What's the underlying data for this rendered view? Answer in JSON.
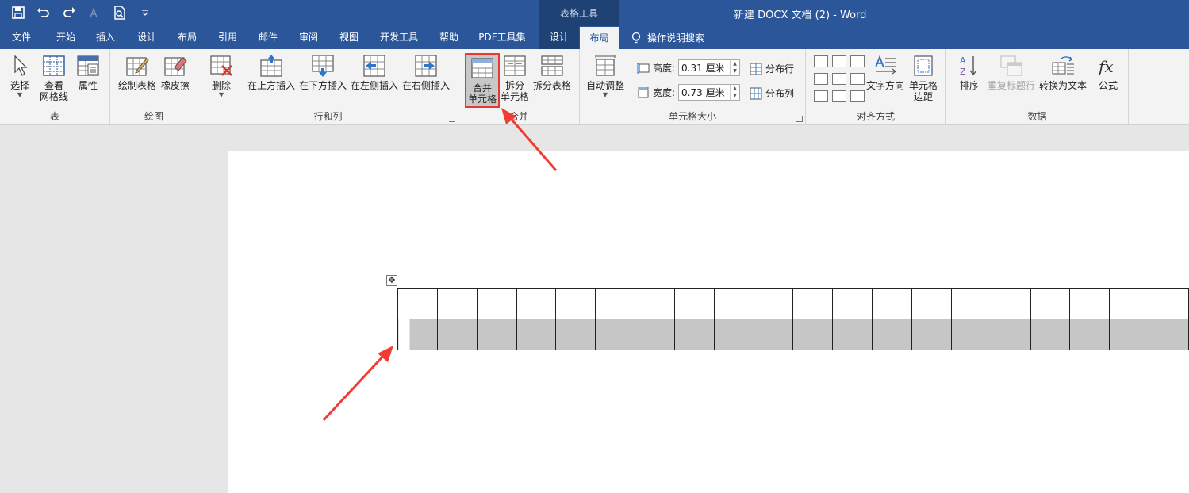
{
  "title_bar": {
    "context_label": "表格工具",
    "doc_title": "新建 DOCX 文档 (2)  -  Word",
    "qat_icons": [
      "save-icon",
      "undo-icon",
      "redo-icon",
      "font-size-icon",
      "print-preview-icon",
      "customize-qat-icon"
    ]
  },
  "tabs": [
    {
      "label": "文件"
    },
    {
      "label": "开始"
    },
    {
      "label": "插入"
    },
    {
      "label": "设计"
    },
    {
      "label": "布局"
    },
    {
      "label": "引用"
    },
    {
      "label": "邮件"
    },
    {
      "label": "审阅"
    },
    {
      "label": "视图"
    },
    {
      "label": "开发工具"
    },
    {
      "label": "帮助"
    },
    {
      "label": "PDF工具集"
    },
    {
      "label": "设计"
    },
    {
      "label": "布局"
    }
  ],
  "active_tab": "布局",
  "tell_me": "操作说明搜索",
  "ribbon": {
    "table_group": {
      "label": "表",
      "select": "选择",
      "gridlines_line1": "查看",
      "gridlines_line2": "网格线",
      "properties": "属性"
    },
    "draw_group": {
      "label": "绘图",
      "draw_table": "绘制表格",
      "eraser": "橡皮擦"
    },
    "rows_cols_group": {
      "label": "行和列",
      "delete": "删除",
      "insert_above": "在上方插入",
      "insert_below": "在下方插入",
      "insert_left": "在左侧插入",
      "insert_right": "在右侧插入"
    },
    "merge_group": {
      "label": "合并",
      "merge_line1": "合并",
      "merge_line2": "单元格",
      "split_line1": "拆分",
      "split_line2": "单元格",
      "split_table": "拆分表格"
    },
    "cell_size_group": {
      "label": "单元格大小",
      "autofit": "自动调整",
      "height_label": "高度:",
      "height_value": "0.31 厘米",
      "width_label": "宽度:",
      "width_value": "0.73 厘米",
      "distribute_rows": "分布行",
      "distribute_cols": "分布列"
    },
    "alignment_group": {
      "label": "对齐方式",
      "text_direction": "文字方向",
      "cell_margins_line1": "单元格",
      "cell_margins_line2": "边距"
    },
    "data_group": {
      "label": "数据",
      "sort": "排序",
      "repeat_header": "重复标题行",
      "convert_to_text": "转换为文本",
      "formula": "公式"
    }
  },
  "document": {
    "table_rows": 2,
    "table_cols": 20,
    "selected_row": 2
  },
  "colors": {
    "brand_blue": "#2b579a",
    "context_blue": "#1f4275",
    "highlight_red": "#e53935",
    "selection_gray": "#c6c6c6"
  }
}
